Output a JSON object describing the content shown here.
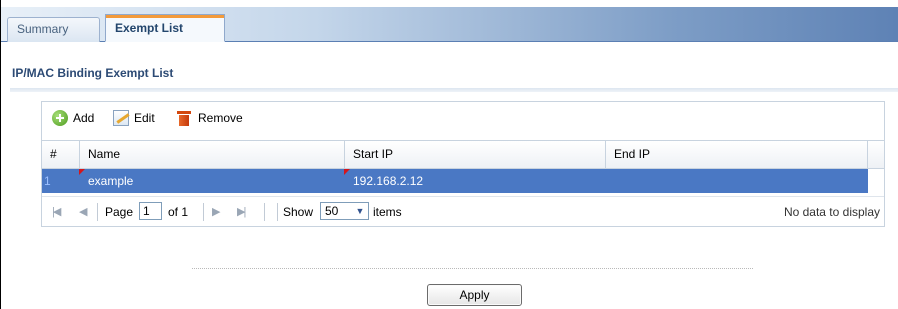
{
  "tabs": [
    {
      "label": "Summary",
      "active": false
    },
    {
      "label": "Exempt List",
      "active": true
    }
  ],
  "section": {
    "title": "IP/MAC Binding Exempt List"
  },
  "toolbar": {
    "add": "Add",
    "edit": "Edit",
    "remove": "Remove"
  },
  "table": {
    "columns": [
      "#",
      "Name",
      "Start IP",
      "End IP"
    ],
    "rows": [
      {
        "num": "1",
        "name": "example",
        "start_ip": "192.168.2.12",
        "end_ip": "",
        "selected": true
      }
    ]
  },
  "pager": {
    "page_label": "Page",
    "page_value": "1",
    "of_label": "of 1",
    "show_label": "Show",
    "page_size": "50",
    "items_label": "items",
    "status": "No data to display"
  },
  "apply_label": "Apply",
  "colors": {
    "selected_row": "#4a78c4",
    "tab_accent": "#f39a3a"
  }
}
